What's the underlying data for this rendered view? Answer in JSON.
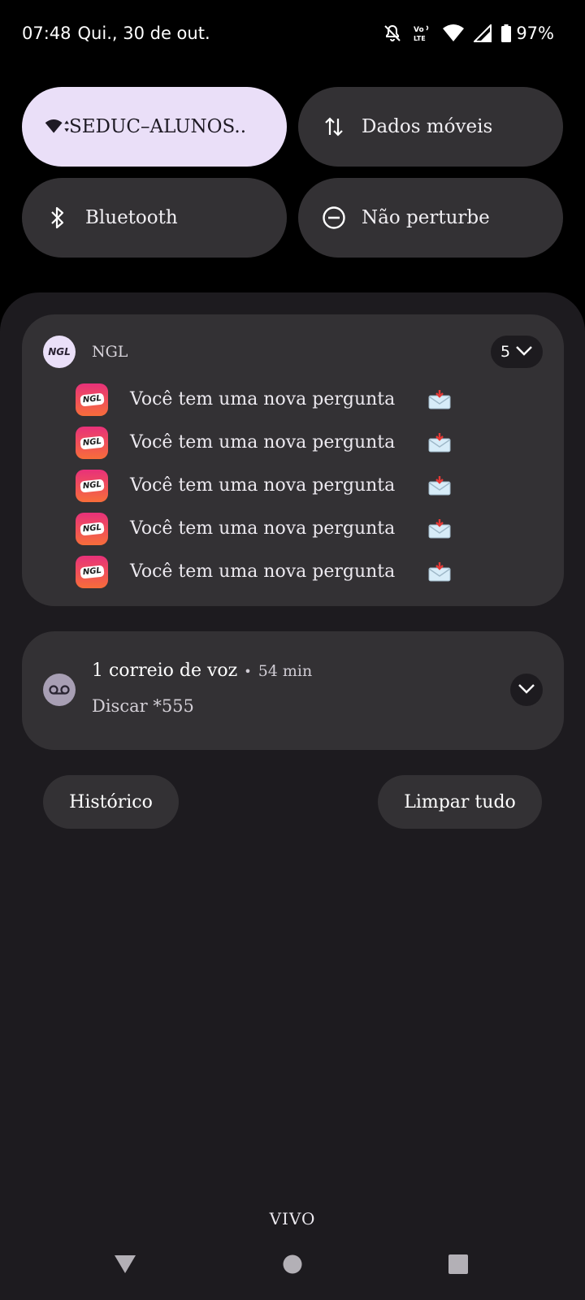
{
  "status_bar": {
    "time": "07:48",
    "date": "Qui., 30 de out.",
    "volte_label_top": "Vo",
    "volte_label_bottom": "LTE",
    "battery": "97%"
  },
  "quick_settings": {
    "tiles": [
      {
        "label": "SEDUC–ALUNOS..",
        "icon": "wifi-icon",
        "active": true
      },
      {
        "label": "Dados móveis",
        "icon": "mobile-data-icon",
        "active": false
      },
      {
        "label": "Bluetooth",
        "icon": "bluetooth-icon",
        "active": false
      },
      {
        "label": "Não perturbe",
        "icon": "do-not-disturb-icon",
        "active": false
      }
    ]
  },
  "notifications": {
    "ngl": {
      "avatar_text": "NGL",
      "app_name": "NGL",
      "count": "5",
      "badge_text": "NGL",
      "messages": [
        "Você tem uma nova pergunta",
        "Você tem uma nova pergunta",
        "Você tem uma nova pergunta",
        "Você tem uma nova pergunta",
        "Você tem uma nova pergunta"
      ]
    },
    "voicemail": {
      "title": "1 correio de voz",
      "separator": "•",
      "time": "54 min",
      "subtitle": "Discar *555"
    }
  },
  "actions": {
    "history_label": "Histórico",
    "clear_label": "Limpar tudo"
  },
  "carrier": "VIVO",
  "colors": {
    "active_tile": "#eadff8",
    "tile": "#333134",
    "shade": "#1d1b1f",
    "ngl_gradient_top": "#e8317a",
    "ngl_gradient_bottom": "#f76d3a"
  }
}
